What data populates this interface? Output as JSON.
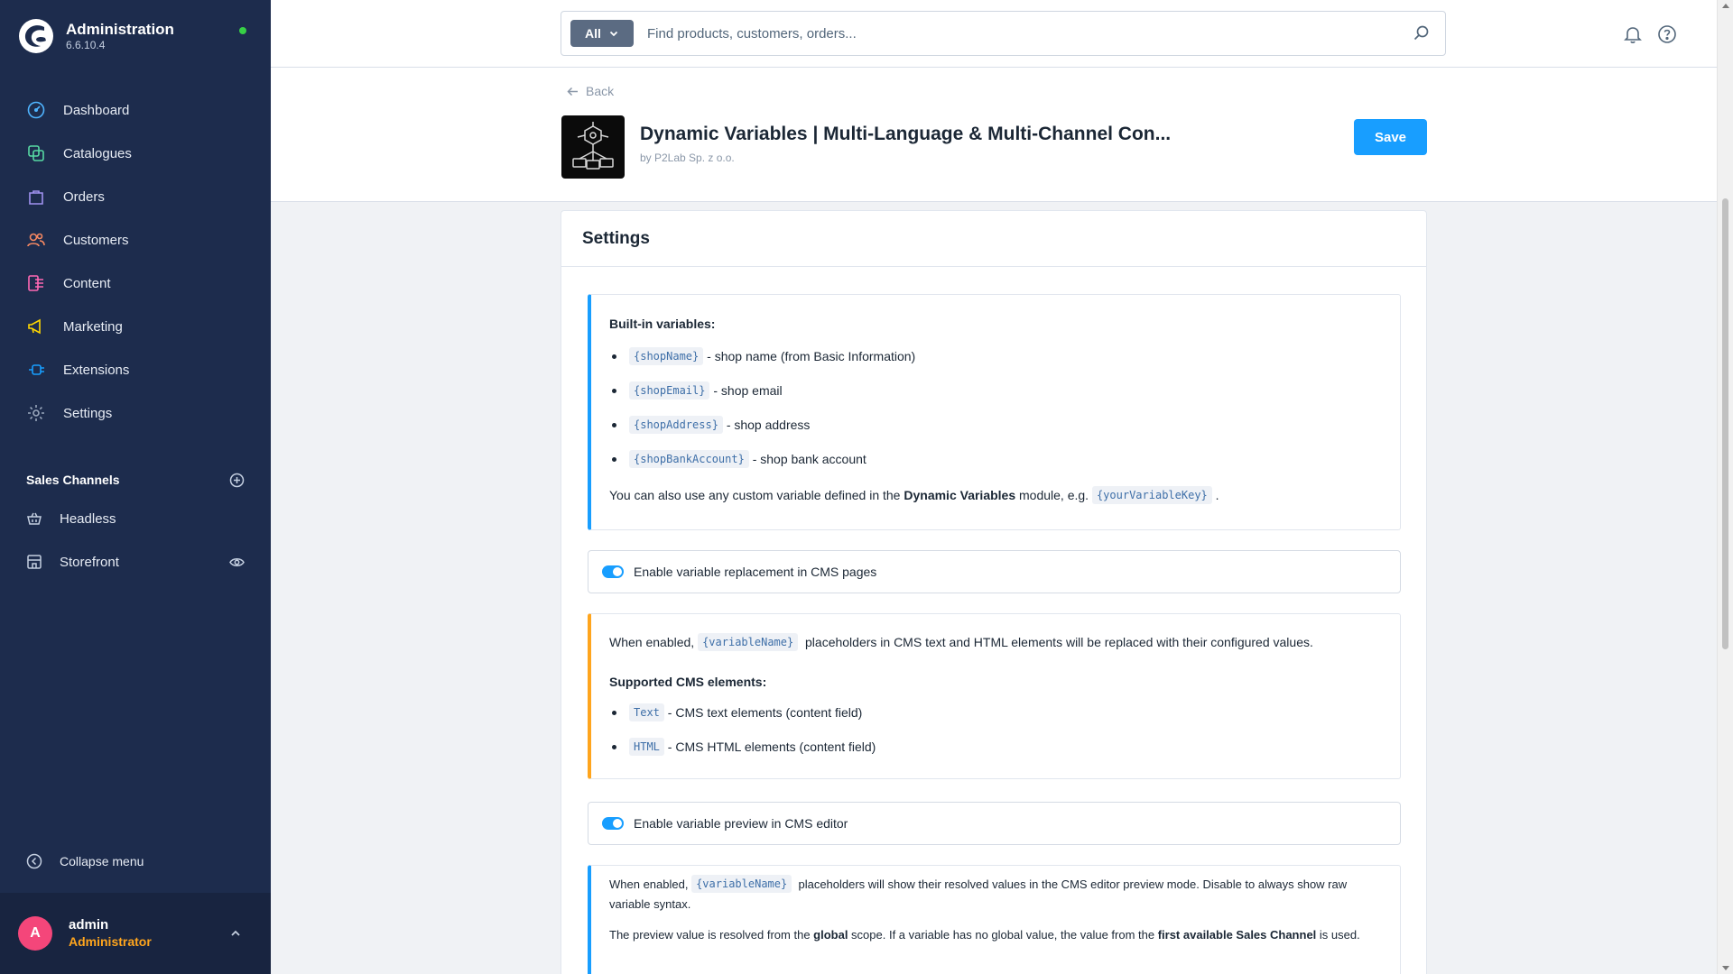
{
  "app": {
    "title": "Administration",
    "version": "6.6.10.4"
  },
  "colors": {
    "sidebar": "#1d2c4d",
    "accent": "#189eff",
    "warning": "#ffa51d",
    "online": "#37d046"
  },
  "nav": {
    "items": [
      {
        "label": "Dashboard",
        "icon": "gauge-icon"
      },
      {
        "label": "Catalogues",
        "icon": "catalogue-icon"
      },
      {
        "label": "Orders",
        "icon": "shopping-bag-icon"
      },
      {
        "label": "Customers",
        "icon": "customers-icon"
      },
      {
        "label": "Content",
        "icon": "content-icon"
      },
      {
        "label": "Marketing",
        "icon": "megaphone-icon"
      },
      {
        "label": "Extensions",
        "icon": "plug-icon"
      },
      {
        "label": "Settings",
        "icon": "gear-icon"
      }
    ]
  },
  "sales_channels": {
    "title": "Sales Channels",
    "items": [
      {
        "label": "Headless",
        "icon": "basket-icon"
      },
      {
        "label": "Storefront",
        "icon": "storefront-icon"
      }
    ]
  },
  "collapse_label": "Collapse menu",
  "user": {
    "initial": "A",
    "name": "admin",
    "role": "Administrator"
  },
  "search": {
    "type_label": "All",
    "placeholder": "Find products, customers, orders..."
  },
  "header": {
    "back_label": "Back",
    "app_title": "Dynamic Variables | Multi-Language & Multi-Channel Con...",
    "vendor": "by P2Lab Sp. z o.o.",
    "save_label": "Save"
  },
  "card": {
    "title": "Settings",
    "builtin": {
      "heading": "Built-in variables:",
      "items": [
        {
          "code": "{shopName}",
          "desc": "- shop name (from Basic Information)"
        },
        {
          "code": "{shopEmail}",
          "desc": "- shop email"
        },
        {
          "code": "{shopAddress}",
          "desc": "- shop address"
        },
        {
          "code": "{shopBankAccount}",
          "desc": "- shop bank account"
        }
      ],
      "custom_pre": "You can also use any custom variable defined in the ",
      "custom_bold": "Dynamic Variables",
      "custom_mid": " module, e.g. ",
      "custom_code": "{yourVariableKey}",
      "custom_post": "."
    },
    "toggle_cms": {
      "label": "Enable variable replacement in CMS pages",
      "enabled": true
    },
    "cms_info": {
      "pre": "When enabled, ",
      "code": "{variableName}",
      "post": " placeholders in CMS text and HTML elements will be replaced with their configured values.",
      "heading": "Supported CMS elements:",
      "items": [
        {
          "code": "Text",
          "desc": "- CMS text elements (content field)"
        },
        {
          "code": "HTML",
          "desc": "- CMS HTML elements (content field)"
        }
      ]
    },
    "toggle_preview": {
      "label": "Enable variable preview in CMS editor",
      "enabled": true
    },
    "preview_info": {
      "pre": "When enabled, ",
      "code": "{variableName}",
      "post": " placeholders will show their resolved values in the CMS editor preview mode. Disable to always show raw variable syntax.",
      "scope_pre": "The preview value is resolved from the ",
      "scope_bold1": "global",
      "scope_mid": " scope. If a variable has no global value, the value from the ",
      "scope_bold2": "first available Sales Channel",
      "scope_post": " is used."
    }
  }
}
